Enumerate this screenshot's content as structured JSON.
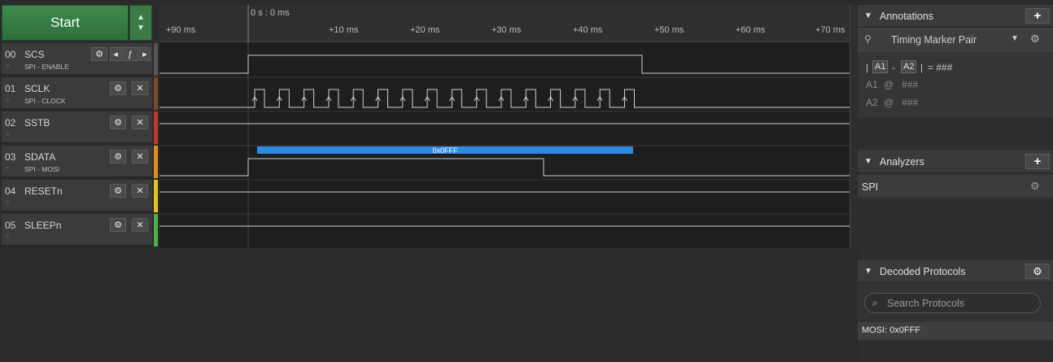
{
  "start_button": {
    "label": "Start"
  },
  "channels": [
    {
      "num": "00",
      "name": "SCS",
      "sub": "SPI - ENABLE",
      "color": "#555555"
    },
    {
      "num": "01",
      "name": "SCLK",
      "sub": "SPI - CLOCK",
      "color": "#7a4a2a"
    },
    {
      "num": "02",
      "name": "SSTB",
      "sub": "",
      "color": "#c0392b"
    },
    {
      "num": "03",
      "name": "SDATA",
      "sub": "SPI - MOSI",
      "color": "#e08a1e"
    },
    {
      "num": "04",
      "name": "RESETn",
      "sub": "",
      "color": "#e5c420"
    },
    {
      "num": "05",
      "name": "SLEEPn",
      "sub": "",
      "color": "#4caf50"
    }
  ],
  "timeline": {
    "origin": "0 s : 0 ms",
    "ticks": [
      "+90 ms",
      "+10 ms",
      "+20 ms",
      "+30 ms",
      "+40 ms",
      "+50 ms",
      "+60 ms",
      "+70 ms"
    ]
  },
  "decoded_bubble": {
    "text": "0x0FFF",
    "color": "#2f8ae0"
  },
  "annotations": {
    "title": "Annotations",
    "add_label": "+",
    "marker": "Timing Marker Pair",
    "formula_a1": "A1",
    "formula_a2": "A2",
    "formula_result": "= ###",
    "a1_label": "A1",
    "a1_value": "@   ###",
    "a2_label": "A2",
    "a2_value": "@   ###"
  },
  "analyzers": {
    "title": "Analyzers",
    "add_label": "+",
    "items": [
      "SPI"
    ]
  },
  "decoded_protocols": {
    "title": "Decoded Protocols",
    "search_placeholder": "Search Protocols",
    "results": [
      "MOSI: 0x0FFF"
    ]
  }
}
